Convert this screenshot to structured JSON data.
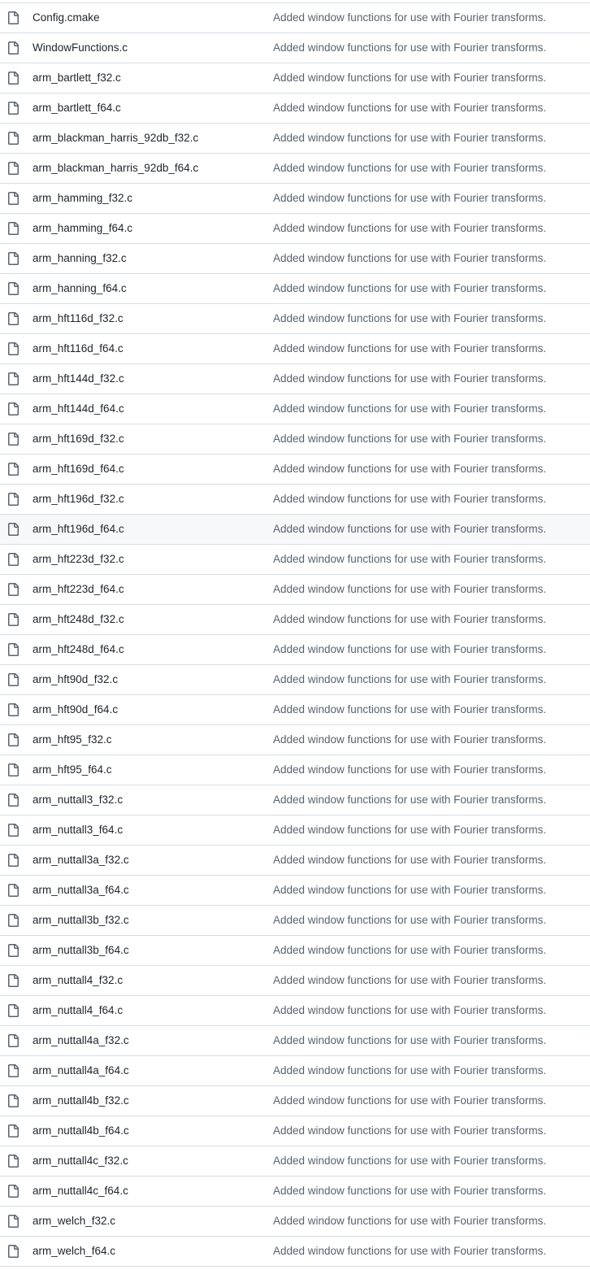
{
  "colors": {
    "border": "#d8dee4",
    "text": "#1f2328",
    "muted_text": "#59636e",
    "hover_row": "#f6f8fa",
    "icon": "#59636e"
  },
  "hovered_file": "arm_hft196d_f64.c",
  "files": [
    {
      "name": "Config.cmake",
      "icon": "file-icon",
      "message": "Added window functions for use with Fourier transforms."
    },
    {
      "name": "WindowFunctions.c",
      "icon": "file-icon",
      "message": "Added window functions for use with Fourier transforms."
    },
    {
      "name": "arm_bartlett_f32.c",
      "icon": "file-icon",
      "message": "Added window functions for use with Fourier transforms."
    },
    {
      "name": "arm_bartlett_f64.c",
      "icon": "file-icon",
      "message": "Added window functions for use with Fourier transforms."
    },
    {
      "name": "arm_blackman_harris_92db_f32.c",
      "icon": "file-icon",
      "message": "Added window functions for use with Fourier transforms."
    },
    {
      "name": "arm_blackman_harris_92db_f64.c",
      "icon": "file-icon",
      "message": "Added window functions for use with Fourier transforms."
    },
    {
      "name": "arm_hamming_f32.c",
      "icon": "file-icon",
      "message": "Added window functions for use with Fourier transforms."
    },
    {
      "name": "arm_hamming_f64.c",
      "icon": "file-icon",
      "message": "Added window functions for use with Fourier transforms."
    },
    {
      "name": "arm_hanning_f32.c",
      "icon": "file-icon",
      "message": "Added window functions for use with Fourier transforms."
    },
    {
      "name": "arm_hanning_f64.c",
      "icon": "file-icon",
      "message": "Added window functions for use with Fourier transforms."
    },
    {
      "name": "arm_hft116d_f32.c",
      "icon": "file-icon",
      "message": "Added window functions for use with Fourier transforms."
    },
    {
      "name": "arm_hft116d_f64.c",
      "icon": "file-icon",
      "message": "Added window functions for use with Fourier transforms."
    },
    {
      "name": "arm_hft144d_f32.c",
      "icon": "file-icon",
      "message": "Added window functions for use with Fourier transforms."
    },
    {
      "name": "arm_hft144d_f64.c",
      "icon": "file-icon",
      "message": "Added window functions for use with Fourier transforms."
    },
    {
      "name": "arm_hft169d_f32.c",
      "icon": "file-icon",
      "message": "Added window functions for use with Fourier transforms."
    },
    {
      "name": "arm_hft169d_f64.c",
      "icon": "file-icon",
      "message": "Added window functions for use with Fourier transforms."
    },
    {
      "name": "arm_hft196d_f32.c",
      "icon": "file-icon",
      "message": "Added window functions for use with Fourier transforms."
    },
    {
      "name": "arm_hft196d_f64.c",
      "icon": "file-icon",
      "message": "Added window functions for use with Fourier transforms."
    },
    {
      "name": "arm_hft223d_f32.c",
      "icon": "file-icon",
      "message": "Added window functions for use with Fourier transforms."
    },
    {
      "name": "arm_hft223d_f64.c",
      "icon": "file-icon",
      "message": "Added window functions for use with Fourier transforms."
    },
    {
      "name": "arm_hft248d_f32.c",
      "icon": "file-icon",
      "message": "Added window functions for use with Fourier transforms."
    },
    {
      "name": "arm_hft248d_f64.c",
      "icon": "file-icon",
      "message": "Added window functions for use with Fourier transforms."
    },
    {
      "name": "arm_hft90d_f32.c",
      "icon": "file-icon",
      "message": "Added window functions for use with Fourier transforms."
    },
    {
      "name": "arm_hft90d_f64.c",
      "icon": "file-icon",
      "message": "Added window functions for use with Fourier transforms."
    },
    {
      "name": "arm_hft95_f32.c",
      "icon": "file-icon",
      "message": "Added window functions for use with Fourier transforms."
    },
    {
      "name": "arm_hft95_f64.c",
      "icon": "file-icon",
      "message": "Added window functions for use with Fourier transforms."
    },
    {
      "name": "arm_nuttall3_f32.c",
      "icon": "file-icon",
      "message": "Added window functions for use with Fourier transforms."
    },
    {
      "name": "arm_nuttall3_f64.c",
      "icon": "file-icon",
      "message": "Added window functions for use with Fourier transforms."
    },
    {
      "name": "arm_nuttall3a_f32.c",
      "icon": "file-icon",
      "message": "Added window functions for use with Fourier transforms."
    },
    {
      "name": "arm_nuttall3a_f64.c",
      "icon": "file-icon",
      "message": "Added window functions for use with Fourier transforms."
    },
    {
      "name": "arm_nuttall3b_f32.c",
      "icon": "file-icon",
      "message": "Added window functions for use with Fourier transforms."
    },
    {
      "name": "arm_nuttall3b_f64.c",
      "icon": "file-icon",
      "message": "Added window functions for use with Fourier transforms."
    },
    {
      "name": "arm_nuttall4_f32.c",
      "icon": "file-icon",
      "message": "Added window functions for use with Fourier transforms."
    },
    {
      "name": "arm_nuttall4_f64.c",
      "icon": "file-icon",
      "message": "Added window functions for use with Fourier transforms."
    },
    {
      "name": "arm_nuttall4a_f32.c",
      "icon": "file-icon",
      "message": "Added window functions for use with Fourier transforms."
    },
    {
      "name": "arm_nuttall4a_f64.c",
      "icon": "file-icon",
      "message": "Added window functions for use with Fourier transforms."
    },
    {
      "name": "arm_nuttall4b_f32.c",
      "icon": "file-icon",
      "message": "Added window functions for use with Fourier transforms."
    },
    {
      "name": "arm_nuttall4b_f64.c",
      "icon": "file-icon",
      "message": "Added window functions for use with Fourier transforms."
    },
    {
      "name": "arm_nuttall4c_f32.c",
      "icon": "file-icon",
      "message": "Added window functions for use with Fourier transforms."
    },
    {
      "name": "arm_nuttall4c_f64.c",
      "icon": "file-icon",
      "message": "Added window functions for use with Fourier transforms."
    },
    {
      "name": "arm_welch_f32.c",
      "icon": "file-icon",
      "message": "Added window functions for use with Fourier transforms."
    },
    {
      "name": "arm_welch_f64.c",
      "icon": "file-icon",
      "message": "Added window functions for use with Fourier transforms."
    }
  ]
}
